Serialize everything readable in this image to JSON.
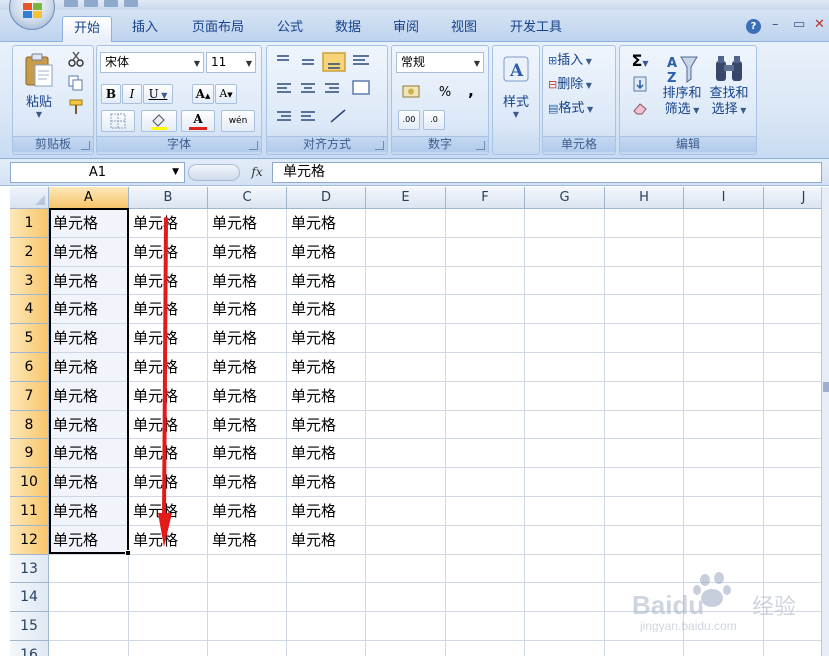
{
  "ribbon_tabs": [
    {
      "label": "开始",
      "active": true
    },
    {
      "label": "插入",
      "active": false
    },
    {
      "label": "页面布局",
      "active": false
    },
    {
      "label": "公式",
      "active": false
    },
    {
      "label": "数据",
      "active": false
    },
    {
      "label": "审阅",
      "active": false
    },
    {
      "label": "视图",
      "active": false
    },
    {
      "label": "开发工具",
      "active": false
    }
  ],
  "clipboard": {
    "paste_label": "粘贴",
    "group_label": "剪贴板"
  },
  "font": {
    "name": "宋体",
    "size": "11",
    "bold": "B",
    "italic": "I",
    "underline": "U",
    "grow": "A",
    "shrink": "A",
    "color_glyph": "A",
    "phonetic": "wén",
    "group_label": "字体"
  },
  "alignment": {
    "group_label": "对齐方式"
  },
  "number": {
    "format": "常规",
    "percent": "%",
    "comma": ",",
    "inc_decimal": ".00",
    "dec_decimal": ".0",
    "group_label": "数字"
  },
  "styles": {
    "label": "样式"
  },
  "cells": {
    "insert_label": "插入",
    "delete_label": "删除",
    "format_label": "格式",
    "group_label": "单元格"
  },
  "editing": {
    "sum_glyph": "Σ",
    "sort_label_1": "排序和",
    "sort_label_2": "筛选",
    "find_label_1": "查找和",
    "find_label_2": "选择",
    "group_label": "编辑"
  },
  "window_controls": {
    "help": "?",
    "min": "–",
    "restore": "▭",
    "close": "✕"
  },
  "formula_bar": {
    "name_box": "A1",
    "fx_label": "fx",
    "formula": "单元格"
  },
  "columns": [
    "A",
    "B",
    "C",
    "D",
    "E",
    "F",
    "G",
    "H",
    "I",
    "J"
  ],
  "selected_column": "A",
  "rows": [
    "1",
    "2",
    "3",
    "4",
    "5",
    "6",
    "7",
    "8",
    "9",
    "10",
    "11",
    "12",
    "13",
    "14",
    "15",
    "16"
  ],
  "selected_rows": [
    "1",
    "2",
    "3",
    "4",
    "5",
    "6",
    "7",
    "8",
    "9",
    "10",
    "11",
    "12"
  ],
  "cell_text": "单元格",
  "filled_columns": [
    "A",
    "B",
    "C",
    "D"
  ],
  "filled_row_count": 12,
  "selection": {
    "range": "A1:A12"
  },
  "annotation": {
    "arrow_color": "#e21a1a",
    "direction": "down"
  },
  "watermark": {
    "brand": "Baidu",
    "cn": "经验",
    "url": "jingyan.baidu.com"
  },
  "colors": {
    "ribbon_text": "#15428b",
    "selection_header": "#f8c56b",
    "gridline": "#d0d7e5"
  }
}
